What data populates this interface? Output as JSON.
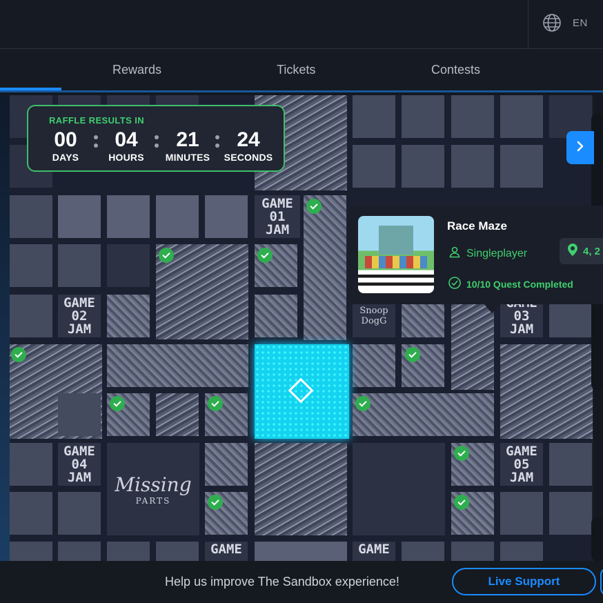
{
  "header": {
    "language": "EN",
    "icons": {
      "language": "globe-icon"
    }
  },
  "tabs": [
    {
      "label": "Rewards"
    },
    {
      "label": "Tickets"
    },
    {
      "label": "Contests"
    }
  ],
  "raffle": {
    "title": "RAFFLE RESULTS IN",
    "days": "00",
    "days_label": "DAYS",
    "hours": "04",
    "hours_label": "HOURS",
    "minutes": "21",
    "minutes_label": "MINUTES",
    "seconds": "24",
    "seconds_label": "SECONDS"
  },
  "map": {
    "jams": [
      {
        "line1": "GAME",
        "line2": "01",
        "line3": "JAM"
      },
      {
        "line1": "GAME",
        "line2": "02",
        "line3": "JAM"
      },
      {
        "line1": "GAME",
        "line2": "03",
        "line3": "JAM"
      },
      {
        "line1": "GAME",
        "line2": "04",
        "line3": "JAM"
      },
      {
        "line1": "GAME",
        "line2": "05",
        "line3": "JAM"
      },
      {
        "line1": "GAME"
      },
      {
        "line1": "GAME"
      }
    ],
    "labels": {
      "snoop": "Snoop DogG",
      "missing": "Missing",
      "parts": "PARTS"
    }
  },
  "card": {
    "title": "Race Maze",
    "mode": "Singleplayer",
    "location": "4, 2",
    "quest": "10/10 Quest Completed",
    "colors": {
      "accent": "#3fcf6f"
    }
  },
  "footer": {
    "feedback_text": "Help us improve The Sandbox experience!",
    "live_support": "Live Support"
  },
  "colors": {
    "primary": "#1a8cff",
    "success": "#3fcf6f",
    "selected_land": "#14d3f0"
  }
}
